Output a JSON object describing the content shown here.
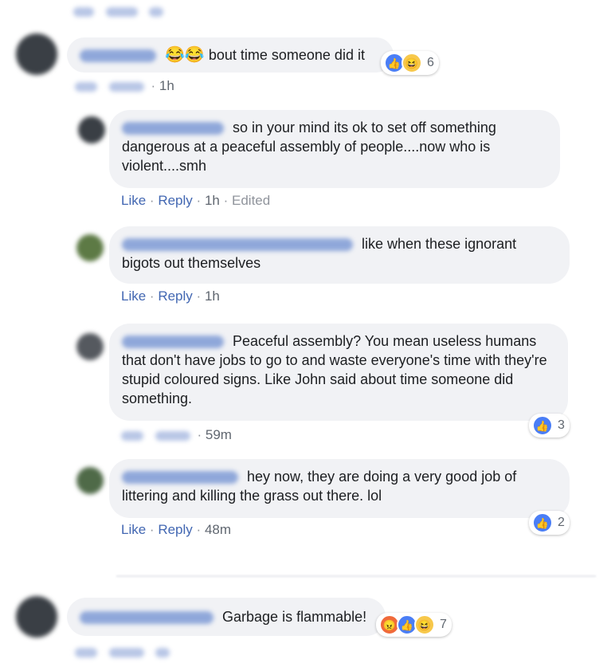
{
  "comments": [
    {
      "emoji": "😂😂",
      "text": "bout time someone did it",
      "reaction_count": "6",
      "time": "1h"
    }
  ],
  "replies": [
    {
      "text": "so in your mind its ok to set off something dangerous at a peaceful assembly of people....now who is violent....smh",
      "like": "Like",
      "reply": "Reply",
      "time": "1h",
      "edited": "Edited"
    },
    {
      "text": "like when these ignorant bigots out themselves",
      "like": "Like",
      "reply": "Reply",
      "time": "1h"
    },
    {
      "text": "Peaceful assembly? You mean useless humans that don't have jobs to go to and waste everyone's time with they're stupid coloured signs. Like John said about time someone did something.",
      "time": "59m",
      "reaction_count": "3"
    },
    {
      "text": "hey now, they are doing a very good job of littering and killing the grass out there. lol",
      "like": "Like",
      "reply": "Reply",
      "time": "48m",
      "reaction_count": "2"
    }
  ],
  "bottom_comment": {
    "text": "Garbage is flammable!",
    "reaction_count": "7"
  },
  "separator": "·",
  "icons": {
    "like": "thumbs-up-icon",
    "haha": "laughing-face-icon",
    "angry": "angry-face-icon"
  },
  "colors": {
    "link": "#4267b2",
    "bubble": "#f1f2f5",
    "muted": "#90949c",
    "like_blue": "#4a7ef6"
  }
}
